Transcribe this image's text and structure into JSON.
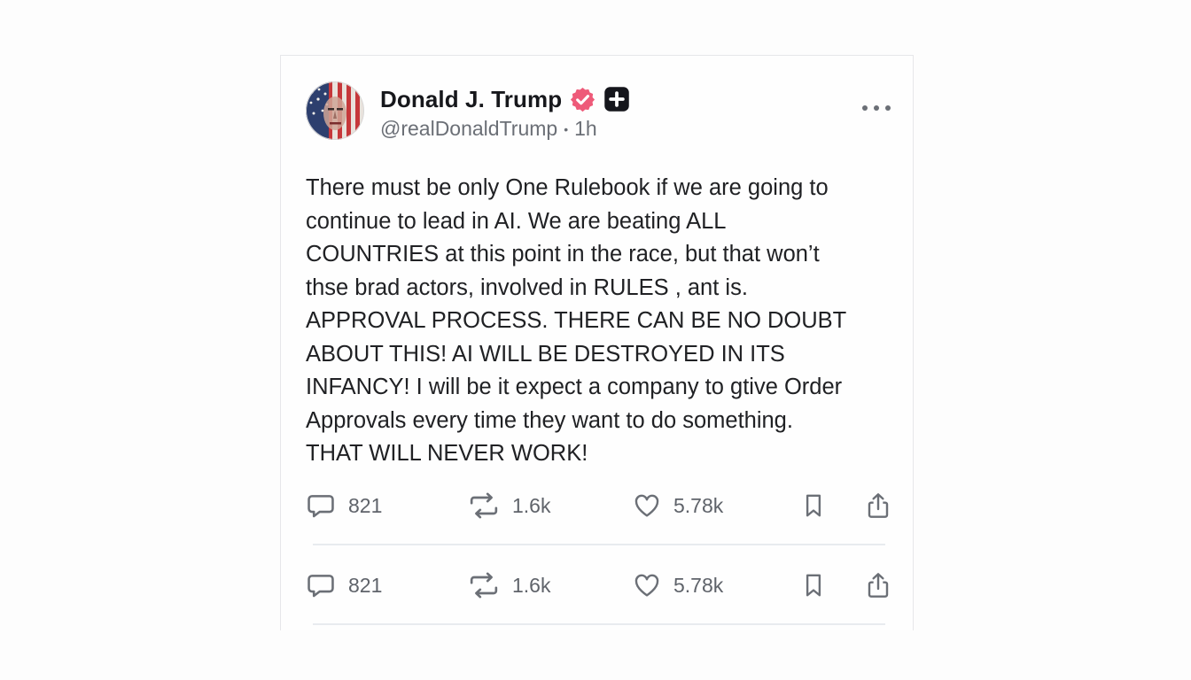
{
  "post": {
    "author_name": "Donald J. Trump",
    "handle": "@realDonaldTrump",
    "separator": "•",
    "time": "1h",
    "lines": [
      "There must be only One Rulebook if we are going to",
      "continue to lead in AI. We are beating ALL",
      "COUNTRIES at this point in the race, but that won’t",
      "thse brad actors, involved in RULES , ant is.",
      "APPROVAL PROCESS. THERE CAN BE NO DOUBT",
      "ABOUT THIS! AI WILL BE DESTROYED IN ITS",
      "INFANCY! I will be it expect a company to gtive Order",
      "Approvals every time they want to do something.",
      "THAT WILL NEVER WORK!"
    ]
  },
  "action_rows": [
    {
      "replies": "821",
      "reposts": "1.6k",
      "likes": "5.78k"
    },
    {
      "replies": "821",
      "reposts": "1.6k",
      "likes": "5.78k"
    }
  ],
  "icons": {
    "verified": "verified-badge-icon",
    "plus": "plus-badge-icon",
    "more": "more-options-icon",
    "reply": "reply-icon",
    "repost": "repost-icon",
    "like": "heart-icon",
    "bookmark": "bookmark-icon",
    "share": "share-icon"
  },
  "colors": {
    "verified_badge": "#ee5a79",
    "plus_badge": "#15161c",
    "icon_gray": "#6b6f76",
    "text": "#202124"
  }
}
